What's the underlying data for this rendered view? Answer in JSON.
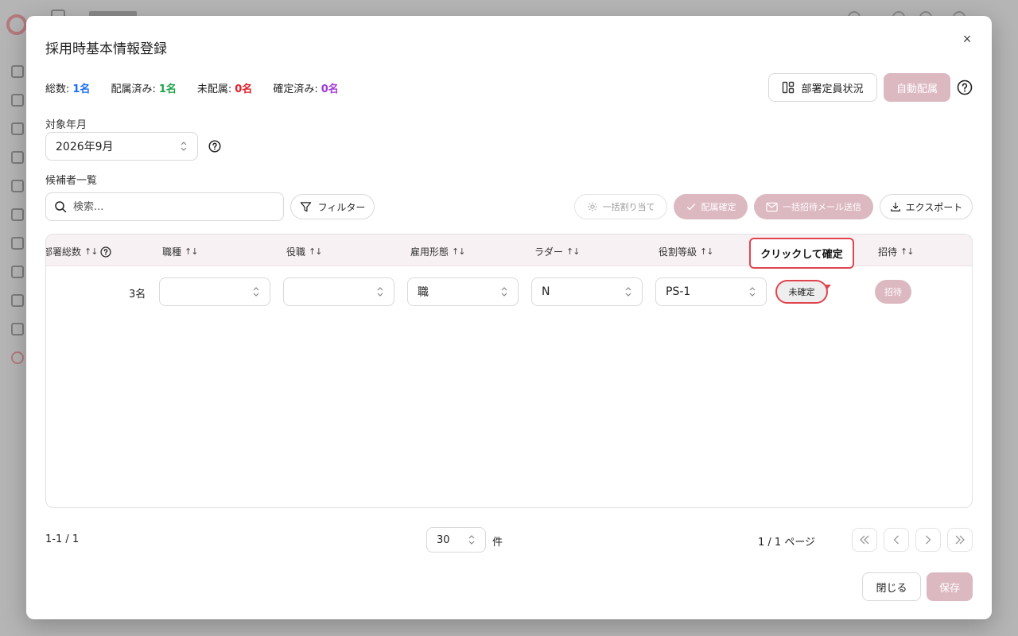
{
  "modal": {
    "title": "採用時基本情報登録",
    "close_icon": "×",
    "stats": {
      "total_label": "総数:",
      "total_value": "1名",
      "assigned_label": "配属済み:",
      "assigned_value": "1名",
      "unassigned_label": "未配属:",
      "unassigned_value": "0名",
      "confirmed_label": "確定済み:",
      "confirmed_value": "0名"
    },
    "dept_button_label": "部署定員状況",
    "auto_assign_label": "自動配属",
    "target_label": "対象年月",
    "target_value": "2026年9月",
    "candidates_label": "候補者一覧",
    "search_placeholder": "検索...",
    "filter_label": "フィルター",
    "bulk_assign_label": "一括割り当て",
    "confirm_assign_label": "配属確定",
    "bulk_mail_label": "一括招待メール送信",
    "export_label": "エクスポート",
    "table": {
      "headers": {
        "dept_total": "部署総数",
        "job": "職種",
        "position": "役職",
        "employment": "雇用形態",
        "ladder": "ラダー",
        "grade": "役割等級",
        "invite": "招待"
      },
      "row": {
        "count": "3名",
        "job": "",
        "position": "",
        "employment": "職",
        "ladder": "N",
        "grade": "PS-1",
        "status": "未確定",
        "invite": "招待"
      }
    },
    "tooltip": "クリックして確定",
    "pagination": {
      "range": "1-1 / 1",
      "per_page": "30",
      "per_page_unit": "件",
      "page_info": "1 / 1 ページ"
    },
    "close_label": "閉じる",
    "save_label": "保存"
  },
  "colors": {
    "total": "#1a6ef5",
    "assigned": "#1fa34a",
    "unassigned": "#e0202a",
    "confirmed": "#a23bd6",
    "accent_pink": "#dcb9c1",
    "highlight_red": "#e0454f"
  }
}
